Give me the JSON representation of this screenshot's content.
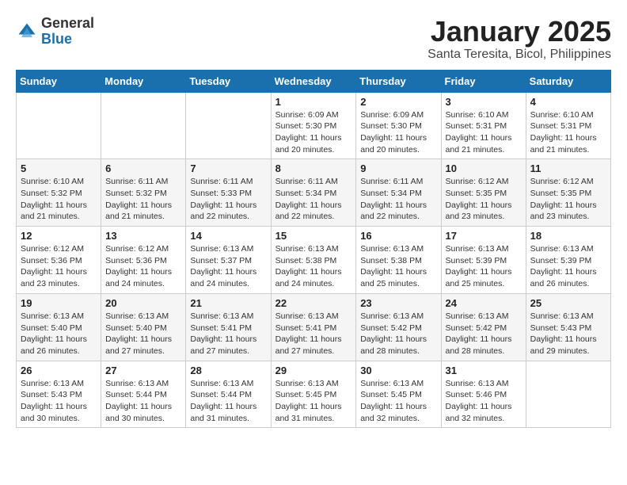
{
  "logo": {
    "text_general": "General",
    "text_blue": "Blue"
  },
  "title": "January 2025",
  "location": "Santa Teresita, Bicol, Philippines",
  "days_of_week": [
    "Sunday",
    "Monday",
    "Tuesday",
    "Wednesday",
    "Thursday",
    "Friday",
    "Saturday"
  ],
  "weeks": [
    [
      {
        "day": "",
        "detail": ""
      },
      {
        "day": "",
        "detail": ""
      },
      {
        "day": "",
        "detail": ""
      },
      {
        "day": "1",
        "detail": "Sunrise: 6:09 AM\nSunset: 5:30 PM\nDaylight: 11 hours\nand 20 minutes."
      },
      {
        "day": "2",
        "detail": "Sunrise: 6:09 AM\nSunset: 5:30 PM\nDaylight: 11 hours\nand 20 minutes."
      },
      {
        "day": "3",
        "detail": "Sunrise: 6:10 AM\nSunset: 5:31 PM\nDaylight: 11 hours\nand 21 minutes."
      },
      {
        "day": "4",
        "detail": "Sunrise: 6:10 AM\nSunset: 5:31 PM\nDaylight: 11 hours\nand 21 minutes."
      }
    ],
    [
      {
        "day": "5",
        "detail": "Sunrise: 6:10 AM\nSunset: 5:32 PM\nDaylight: 11 hours\nand 21 minutes."
      },
      {
        "day": "6",
        "detail": "Sunrise: 6:11 AM\nSunset: 5:32 PM\nDaylight: 11 hours\nand 21 minutes."
      },
      {
        "day": "7",
        "detail": "Sunrise: 6:11 AM\nSunset: 5:33 PM\nDaylight: 11 hours\nand 22 minutes."
      },
      {
        "day": "8",
        "detail": "Sunrise: 6:11 AM\nSunset: 5:34 PM\nDaylight: 11 hours\nand 22 minutes."
      },
      {
        "day": "9",
        "detail": "Sunrise: 6:11 AM\nSunset: 5:34 PM\nDaylight: 11 hours\nand 22 minutes."
      },
      {
        "day": "10",
        "detail": "Sunrise: 6:12 AM\nSunset: 5:35 PM\nDaylight: 11 hours\nand 23 minutes."
      },
      {
        "day": "11",
        "detail": "Sunrise: 6:12 AM\nSunset: 5:35 PM\nDaylight: 11 hours\nand 23 minutes."
      }
    ],
    [
      {
        "day": "12",
        "detail": "Sunrise: 6:12 AM\nSunset: 5:36 PM\nDaylight: 11 hours\nand 23 minutes."
      },
      {
        "day": "13",
        "detail": "Sunrise: 6:12 AM\nSunset: 5:36 PM\nDaylight: 11 hours\nand 24 minutes."
      },
      {
        "day": "14",
        "detail": "Sunrise: 6:13 AM\nSunset: 5:37 PM\nDaylight: 11 hours\nand 24 minutes."
      },
      {
        "day": "15",
        "detail": "Sunrise: 6:13 AM\nSunset: 5:38 PM\nDaylight: 11 hours\nand 24 minutes."
      },
      {
        "day": "16",
        "detail": "Sunrise: 6:13 AM\nSunset: 5:38 PM\nDaylight: 11 hours\nand 25 minutes."
      },
      {
        "day": "17",
        "detail": "Sunrise: 6:13 AM\nSunset: 5:39 PM\nDaylight: 11 hours\nand 25 minutes."
      },
      {
        "day": "18",
        "detail": "Sunrise: 6:13 AM\nSunset: 5:39 PM\nDaylight: 11 hours\nand 26 minutes."
      }
    ],
    [
      {
        "day": "19",
        "detail": "Sunrise: 6:13 AM\nSunset: 5:40 PM\nDaylight: 11 hours\nand 26 minutes."
      },
      {
        "day": "20",
        "detail": "Sunrise: 6:13 AM\nSunset: 5:40 PM\nDaylight: 11 hours\nand 27 minutes."
      },
      {
        "day": "21",
        "detail": "Sunrise: 6:13 AM\nSunset: 5:41 PM\nDaylight: 11 hours\nand 27 minutes."
      },
      {
        "day": "22",
        "detail": "Sunrise: 6:13 AM\nSunset: 5:41 PM\nDaylight: 11 hours\nand 27 minutes."
      },
      {
        "day": "23",
        "detail": "Sunrise: 6:13 AM\nSunset: 5:42 PM\nDaylight: 11 hours\nand 28 minutes."
      },
      {
        "day": "24",
        "detail": "Sunrise: 6:13 AM\nSunset: 5:42 PM\nDaylight: 11 hours\nand 28 minutes."
      },
      {
        "day": "25",
        "detail": "Sunrise: 6:13 AM\nSunset: 5:43 PM\nDaylight: 11 hours\nand 29 minutes."
      }
    ],
    [
      {
        "day": "26",
        "detail": "Sunrise: 6:13 AM\nSunset: 5:43 PM\nDaylight: 11 hours\nand 30 minutes."
      },
      {
        "day": "27",
        "detail": "Sunrise: 6:13 AM\nSunset: 5:44 PM\nDaylight: 11 hours\nand 30 minutes."
      },
      {
        "day": "28",
        "detail": "Sunrise: 6:13 AM\nSunset: 5:44 PM\nDaylight: 11 hours\nand 31 minutes."
      },
      {
        "day": "29",
        "detail": "Sunrise: 6:13 AM\nSunset: 5:45 PM\nDaylight: 11 hours\nand 31 minutes."
      },
      {
        "day": "30",
        "detail": "Sunrise: 6:13 AM\nSunset: 5:45 PM\nDaylight: 11 hours\nand 32 minutes."
      },
      {
        "day": "31",
        "detail": "Sunrise: 6:13 AM\nSunset: 5:46 PM\nDaylight: 11 hours\nand 32 minutes."
      },
      {
        "day": "",
        "detail": ""
      }
    ]
  ]
}
